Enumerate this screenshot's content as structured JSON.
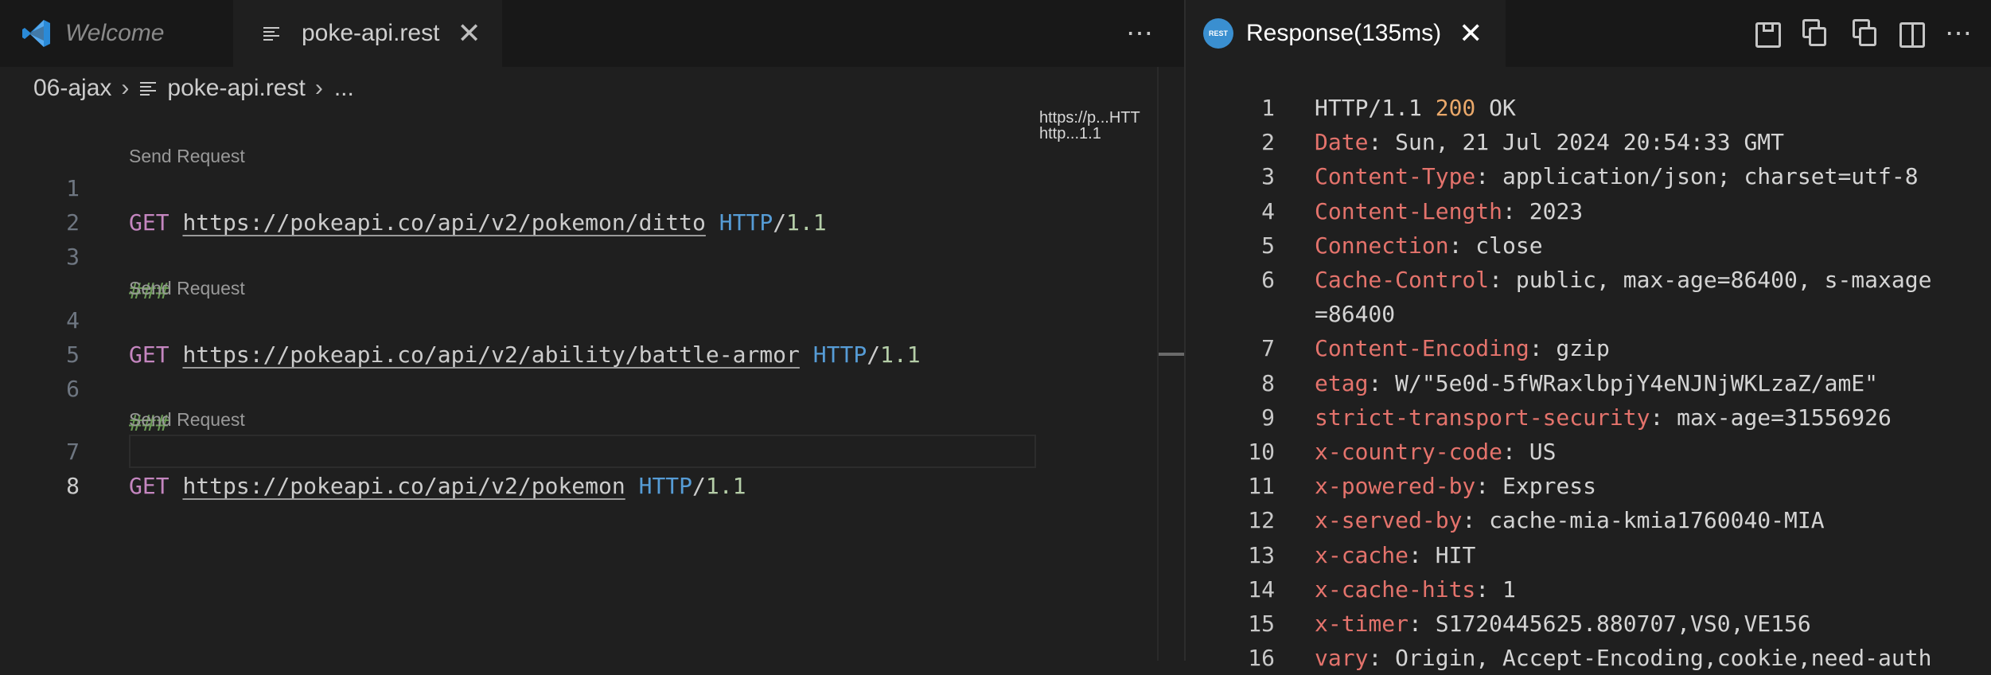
{
  "left": {
    "tabs": [
      {
        "label": "Welcome",
        "icon": "vscode-logo-icon"
      },
      {
        "label": "poke-api.rest",
        "icon": "lines-icon",
        "close": "✕"
      }
    ],
    "more": "⋯",
    "breadcrumb": {
      "folder": "06-ajax",
      "file": "poke-api.rest",
      "rest": "..."
    },
    "codelens": "Send Request",
    "lines": [
      {
        "n": "1",
        "method": "GET",
        "url": "https://pokeapi.co/api/v2/pokemon/ditto",
        "http": "HTTP",
        "ver": "1.1"
      },
      {
        "n": "2"
      },
      {
        "n": "3",
        "sep": "###"
      },
      {
        "n": "4",
        "method": "GET",
        "url": "https://pokeapi.co/api/v2/ability/battle-armor",
        "http": "HTTP",
        "ver": "1.1"
      },
      {
        "n": "5"
      },
      {
        "n": "6",
        "sep": "###"
      },
      {
        "n": "7",
        "method": "GET",
        "url": "https://pokeapi.co/api/v2/pokemon",
        "http": "HTTP",
        "ver": "1.1"
      },
      {
        "n": "8"
      }
    ],
    "minimap": {
      "line1": "https://p...HTT",
      "line2": "http...1.1"
    }
  },
  "right": {
    "tab": {
      "label": "Response(135ms)",
      "icon_text": "REST",
      "close": "✕"
    },
    "actions_more": "⋯",
    "lines": [
      {
        "n": "1",
        "proto": "HTTP/1.1 ",
        "status": "200",
        "status_text": " OK"
      },
      {
        "n": "2",
        "name": "Date",
        "value": ": Sun, 21 Jul 2024 20:54:33 GMT"
      },
      {
        "n": "3",
        "name": "Content-Type",
        "value": ": application/json; charset=utf-8"
      },
      {
        "n": "4",
        "name": "Content-Length",
        "value": ": 2023"
      },
      {
        "n": "5",
        "name": "Connection",
        "value": ": close"
      },
      {
        "n": "6",
        "name": "Cache-Control",
        "value": ": public, max-age=86400, s-maxage"
      },
      {
        "n": "",
        "cont": "=86400"
      },
      {
        "n": "7",
        "name": "Content-Encoding",
        "value": ": gzip"
      },
      {
        "n": "8",
        "name": "etag",
        "value": ": W/\"5e0d-5fWRaxlbpjY4eNJNjWKLzaZ/amE\""
      },
      {
        "n": "9",
        "name": "strict-transport-security",
        "value": ": max-age=31556926"
      },
      {
        "n": "10",
        "name": "x-country-code",
        "value": ": US"
      },
      {
        "n": "11",
        "name": "x-powered-by",
        "value": ": Express"
      },
      {
        "n": "12",
        "name": "x-served-by",
        "value": ": cache-mia-kmia1760040-MIA"
      },
      {
        "n": "13",
        "name": "x-cache",
        "value": ": HIT"
      },
      {
        "n": "14",
        "name": "x-cache-hits",
        "value": ": 1"
      },
      {
        "n": "15",
        "name": "x-timer",
        "value": ": S1720445625.880707,VS0,VE156"
      },
      {
        "n": "16",
        "name": "vary",
        "value": ": Origin, Accept-Encoding,cookie,need-auth"
      }
    ]
  },
  "colors": {
    "editor_bg": "#1f1f1f",
    "tab_bg": "#181818",
    "method": "#c586c0",
    "http": "#569cd6",
    "version": "#b5cea8",
    "separator": "#6a9955",
    "header_name": "#e4736c",
    "status": "#e9a86a"
  }
}
